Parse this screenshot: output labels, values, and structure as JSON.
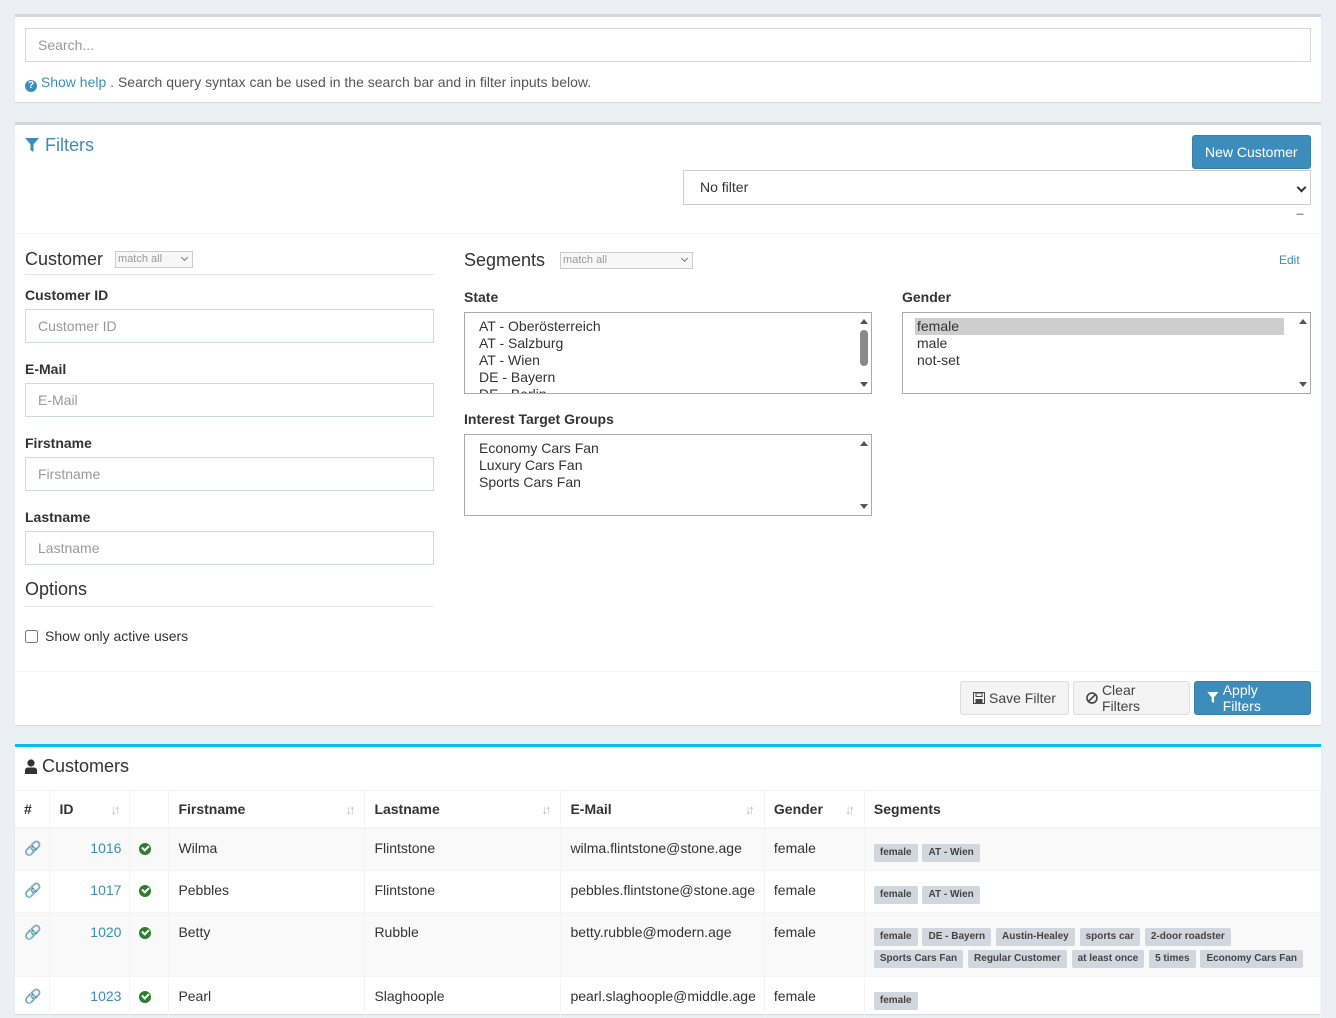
{
  "search": {
    "placeholder": "Search...",
    "help_link": "Show help",
    "help_text": ". Search query syntax can be used in the search bar and in filter inputs below."
  },
  "filters": {
    "title": "Filters",
    "new_customer": "New Customer",
    "filter_select": "No filter",
    "collapse": "−",
    "customer_section": {
      "title": "Customer",
      "match": "match all",
      "fields": [
        {
          "label": "Customer ID",
          "placeholder": "Customer ID"
        },
        {
          "label": "E-Mail",
          "placeholder": "E-Mail"
        },
        {
          "label": "Firstname",
          "placeholder": "Firstname"
        },
        {
          "label": "Lastname",
          "placeholder": "Lastname"
        }
      ]
    },
    "options": {
      "title": "Options",
      "active_only": "Show only active users"
    },
    "segments_section": {
      "title": "Segments",
      "match": "match all",
      "edit": "Edit",
      "state": {
        "label": "State",
        "options": [
          "AT - Oberösterreich",
          "AT - Salzburg",
          "AT - Wien",
          "DE - Bayern",
          "DE - Berlin"
        ]
      },
      "gender": {
        "label": "Gender",
        "options": [
          "female",
          "male",
          "not-set"
        ],
        "selected": "female"
      },
      "interest": {
        "label": "Interest Target Groups",
        "options": [
          "Economy Cars Fan",
          "Luxury Cars Fan",
          "Sports Cars Fan"
        ]
      }
    },
    "buttons": {
      "save": "Save Filter",
      "clear": "Clear Filters",
      "apply": "Apply Filters"
    }
  },
  "customers": {
    "title": "Customers",
    "columns": [
      "#",
      "ID",
      "",
      "Firstname",
      "Lastname",
      "E-Mail",
      "Gender",
      "Segments"
    ],
    "rows": [
      {
        "id": "1016",
        "firstname": "Wilma",
        "lastname": "Flintstone",
        "email": "wilma.flintstone@stone.age",
        "gender": "female",
        "segments": [
          "female",
          "AT - Wien"
        ]
      },
      {
        "id": "1017",
        "firstname": "Pebbles",
        "lastname": "Flintstone",
        "email": "pebbles.flintstone@stone.age",
        "gender": "female",
        "segments": [
          "female",
          "AT - Wien"
        ]
      },
      {
        "id": "1020",
        "firstname": "Betty",
        "lastname": "Rubble",
        "email": "betty.rubble@modern.age",
        "gender": "female",
        "segments": [
          "female",
          "DE - Bayern",
          "Austin-Healey",
          "sports car",
          "2-door roadster",
          "Sports Cars Fan",
          "Regular Customer",
          "at least once",
          "5 times",
          "Economy Cars Fan"
        ]
      },
      {
        "id": "1023",
        "firstname": "Pearl",
        "lastname": "Slaghoople",
        "email": "pearl.slaghoople@middle.age",
        "gender": "female",
        "segments": [
          "female"
        ]
      }
    ]
  }
}
